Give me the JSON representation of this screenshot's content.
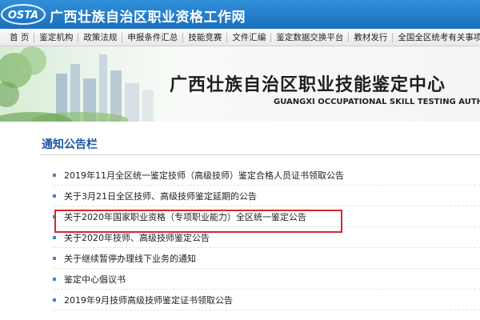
{
  "header": {
    "logo_text": "OSTA",
    "title": "广西壮族自治区职业资格工作网"
  },
  "nav": {
    "items": [
      "首 页",
      "鉴定机构",
      "政策法规",
      "申报条件汇总",
      "技能竞赛",
      "文件汇编",
      "鉴定数据交换平台",
      "教材发行",
      "全国全区统考有关事项通知"
    ]
  },
  "banner": {
    "title": "广西壮族自治区职业技能鉴定中心",
    "subtitle": "GUANGXI OCCUPATIONAL SKILL TESTING AUTHO"
  },
  "notices": {
    "section_title": "通知公告栏",
    "items": [
      "2019年11月全区统一鉴定技师（高级技师）鉴定合格人员证书领取公告",
      "关于3月21日全区技师、高级技师鉴定延期的公告",
      "关于2020年国家职业资格（专项职业能力）全区统一鉴定公告",
      "关于2020年技师、高级技师鉴定公告",
      "关于继续暂停办理线下业务的通知",
      "鉴定中心倡议书",
      "2019年9月技师高级技师鉴定证书领取公告"
    ],
    "highlighted_index": 2
  },
  "colors": {
    "header_blue": "#1c6fbd",
    "section_title_blue": "#1c57a8",
    "highlight_red": "#d8262f"
  }
}
